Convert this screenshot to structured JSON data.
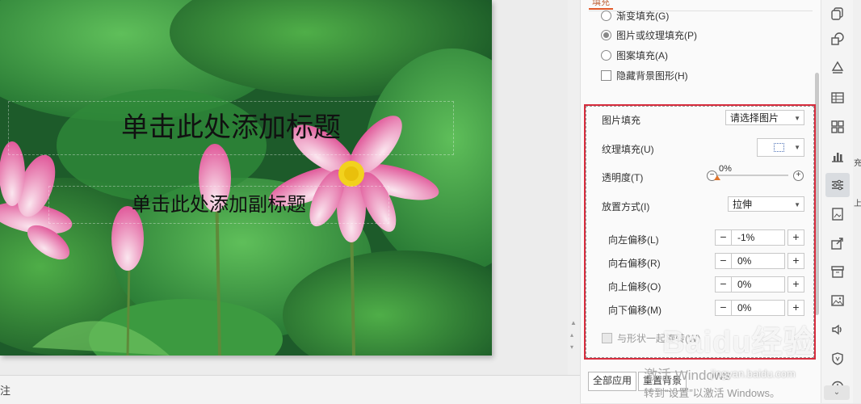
{
  "slide": {
    "title_placeholder": "单击此处添加标题",
    "subtitle_placeholder": "单击此处添加副标题"
  },
  "statusbar": {
    "notes_label": "注"
  },
  "panel": {
    "tab_label": "填充",
    "fill_options": [
      {
        "label": "渐变填充(G)",
        "selected": false
      },
      {
        "label": "图片或纹理填充(P)",
        "selected": true
      },
      {
        "label": "图案填充(A)",
        "selected": false
      }
    ],
    "hide_background_label": "隐藏背景图形(H)",
    "picture_fill": {
      "label": "图片填充",
      "value": "请选择图片"
    },
    "texture_fill": {
      "label": "纹理填充(U)"
    },
    "transparency": {
      "label": "透明度(T)",
      "value": "0%",
      "percent": 0
    },
    "placement": {
      "label": "放置方式(I)",
      "value": "拉伸"
    },
    "offsets": [
      {
        "label": "向左偏移(L)",
        "value": "-1%"
      },
      {
        "label": "向右偏移(R)",
        "value": "0%"
      },
      {
        "label": "向上偏移(O)",
        "value": "0%"
      },
      {
        "label": "向下偏移(M)",
        "value": "0%"
      }
    ],
    "rotate_with_shape_label": "与形状一起旋转(W)",
    "apply_all_label": "全部应用",
    "reset_background_label": "重置背景",
    "activation_title": "激活 Windows",
    "activation_sub": "转到“设置”以激活 Windows。"
  },
  "watermark": {
    "text": "Baidu经验",
    "sub": "jingyan.baidu.com"
  },
  "right_edge": {
    "text1": "充",
    "text2": "上"
  },
  "toolstrip": [
    "copy-icon",
    "shape-icon",
    "fill-bucket-icon",
    "table-icon",
    "grid-icon",
    "chart-icon",
    "settings-sliders-icon",
    "image-gallery-icon",
    "share-icon",
    "archive-icon",
    "picture-icon",
    "speaker-icon",
    "shield-icon",
    "clock-icon"
  ],
  "colors": {
    "accent": "#e25a2a",
    "highlight_box": "#d72d3e"
  }
}
